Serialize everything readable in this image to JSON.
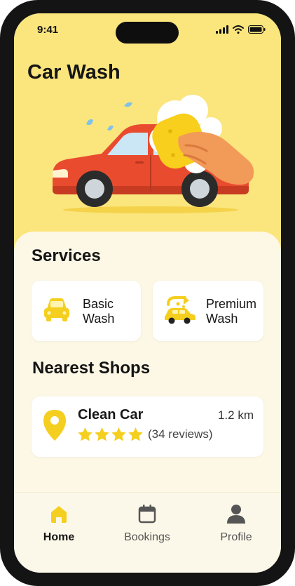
{
  "status": {
    "time": "9:41"
  },
  "header": {
    "title": "Car Wash"
  },
  "services": {
    "title": "Services",
    "items": [
      {
        "label": "Basic\nWash",
        "icon": "car-front-icon"
      },
      {
        "label": "Premium\nWash",
        "icon": "car-wash-icon"
      }
    ]
  },
  "shops": {
    "title": "Nearest Shops",
    "items": [
      {
        "name": "Clean Car",
        "distance": "1.2 km",
        "stars": 4,
        "reviews": "(34 reviews)",
        "icon": "location-pin-icon"
      }
    ]
  },
  "nav": {
    "items": [
      {
        "label": "Home",
        "icon": "home-icon",
        "active": true
      },
      {
        "label": "Bookings",
        "icon": "calendar-icon",
        "active": false
      },
      {
        "label": "Profile",
        "icon": "user-icon",
        "active": false
      }
    ]
  },
  "colors": {
    "accent": "#f5cf1f",
    "background": "#fbe57d",
    "car": "#e94b2f"
  }
}
